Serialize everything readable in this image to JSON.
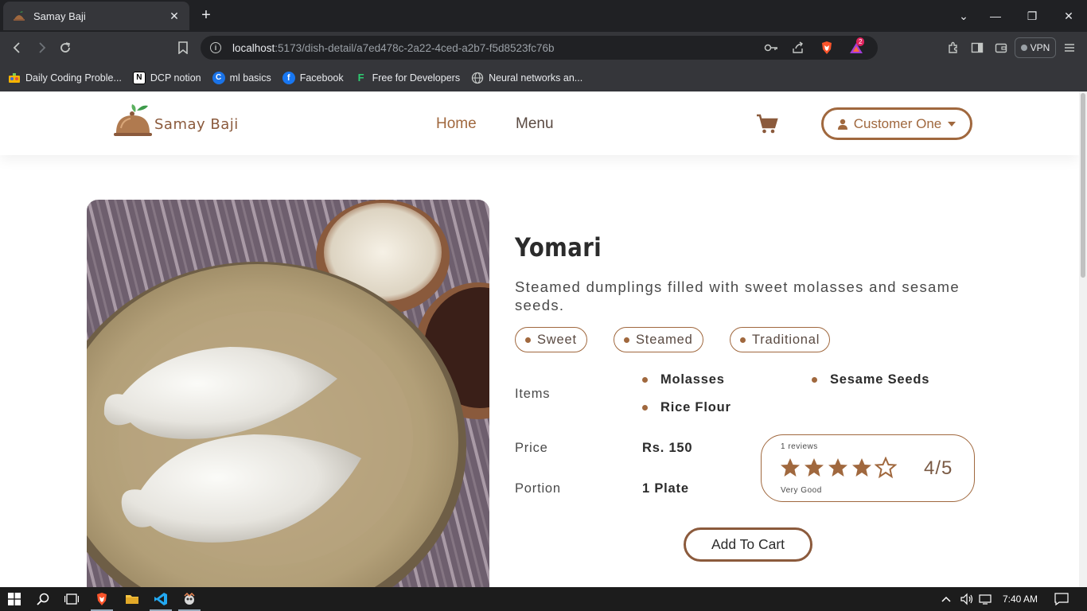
{
  "browser": {
    "tab_title": "Samay Baji",
    "url_host": "localhost",
    "url_rest": ":5173/dish-detail/a7ed478c-2a22-4ced-a2b7-f5d8523fc76b",
    "vpn_label": "VPN",
    "rewards_badge": "2",
    "bookmarks": [
      {
        "label": "Daily Coding Proble...",
        "icon": "daily-coding-icon",
        "color": "#f5b400"
      },
      {
        "label": "DCP notion",
        "icon": "notion-icon",
        "color": "#ffffff"
      },
      {
        "label": "ml basics",
        "icon": "c-icon",
        "color": "#1a73e8"
      },
      {
        "label": "Facebook",
        "icon": "facebook-icon",
        "color": "#1877f2"
      },
      {
        "label": "Free for Developers",
        "icon": "f-icon",
        "color": "#2ecc71"
      },
      {
        "label": "Neural networks an...",
        "icon": "globe-icon",
        "color": "#9aa0a6"
      }
    ]
  },
  "site": {
    "brand": "Samay Baji",
    "nav": {
      "home": "Home",
      "menu": "Menu"
    },
    "user_name": "Customer One",
    "accent_color": "#a0683e"
  },
  "dish": {
    "name": "Yomari",
    "description": "Steamed dumplings filled with sweet molasses and sesame seeds.",
    "tags": [
      "Sweet",
      "Steamed",
      "Traditional"
    ],
    "items_label": "Items",
    "items": [
      "Molasses",
      "Sesame Seeds",
      "Rice Flour"
    ],
    "price_label": "Price",
    "price": "Rs. 150",
    "portion_label": "Portion",
    "portion": "1 Plate",
    "review_count": "1 reviews",
    "rating": 4,
    "rating_max": 5,
    "rating_display": "4/5",
    "rating_text": "Very Good",
    "add_to_cart": "Add To Cart"
  },
  "taskbar": {
    "time": "7:40 AM"
  }
}
